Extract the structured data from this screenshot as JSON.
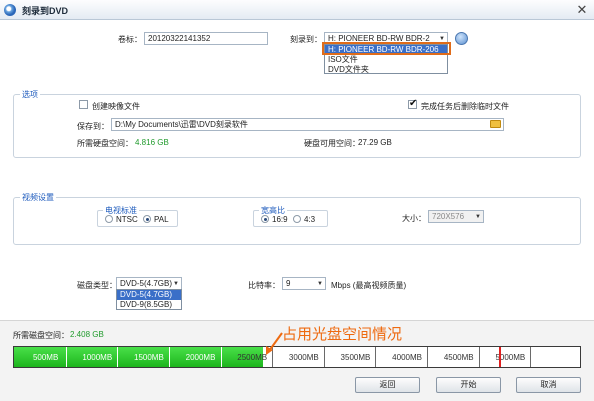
{
  "window": {
    "title": "刻录到DVD"
  },
  "top": {
    "volume_label": "卷标：",
    "volume_value": "20120322141352",
    "burn_to_label": "刻录到：",
    "burn_to_value": "H: PIONEER  BD-RW   BDR-2",
    "burn_to_options": [
      "H: PIONEER  BD-RW   BDR-206",
      "ISO文件",
      "DVD文件夹"
    ]
  },
  "options": {
    "title": "选项",
    "create_image_label": "创建映像文件",
    "create_image_checked": false,
    "delete_temp_label": "完成任务后删除临时文件",
    "delete_temp_checked": true,
    "save_to_label": "保存到：",
    "save_to_value": "D:\\My Documents\\迅雷\\DVD刻录软件",
    "required_space_label": "所需硬盘空间：",
    "required_space_value": "4.816 GB",
    "available_space_label": "硬盘可用空间：",
    "available_space_value": "27.29 GB"
  },
  "video": {
    "title": "视频设置",
    "tv_standard_title": "电视标准",
    "tv_options": [
      "NTSC",
      "PAL"
    ],
    "tv_selected": "PAL",
    "aspect_title": "宽高比",
    "aspect_options": [
      "16:9",
      "4:3"
    ],
    "aspect_selected": "16:9",
    "size_label": "大小：",
    "size_value": "720X576"
  },
  "disc": {
    "type_label": "磁盘类型：",
    "type_value": "DVD-5(4.7GB)",
    "type_options": [
      "DVD-5(4.7GB)",
      "DVD-9(8.5GB)"
    ],
    "bitrate_label": "比特率：",
    "bitrate_value": "9",
    "bitrate_unit": "Mbps (最高视频质量)"
  },
  "usage": {
    "label": "所需磁盘空间：",
    "value": "2.408 GB",
    "used_mb": 2408,
    "max_mb": 5500,
    "capacity_mb": 4700,
    "ticks": [
      "500MB",
      "1000MB",
      "1500MB",
      "2000MB",
      "2500MB",
      "3000MB",
      "3500MB",
      "4000MB",
      "4500MB",
      "5000MB"
    ],
    "annotation": "占用光盘空间情况"
  },
  "buttons": {
    "back": "返回",
    "start": "开始",
    "cancel": "取消"
  },
  "colors": {
    "accent": "#1e5bbd",
    "highlight": "#e06c1a",
    "fill": "#1db51d",
    "green_text": "#1f9a2b"
  }
}
